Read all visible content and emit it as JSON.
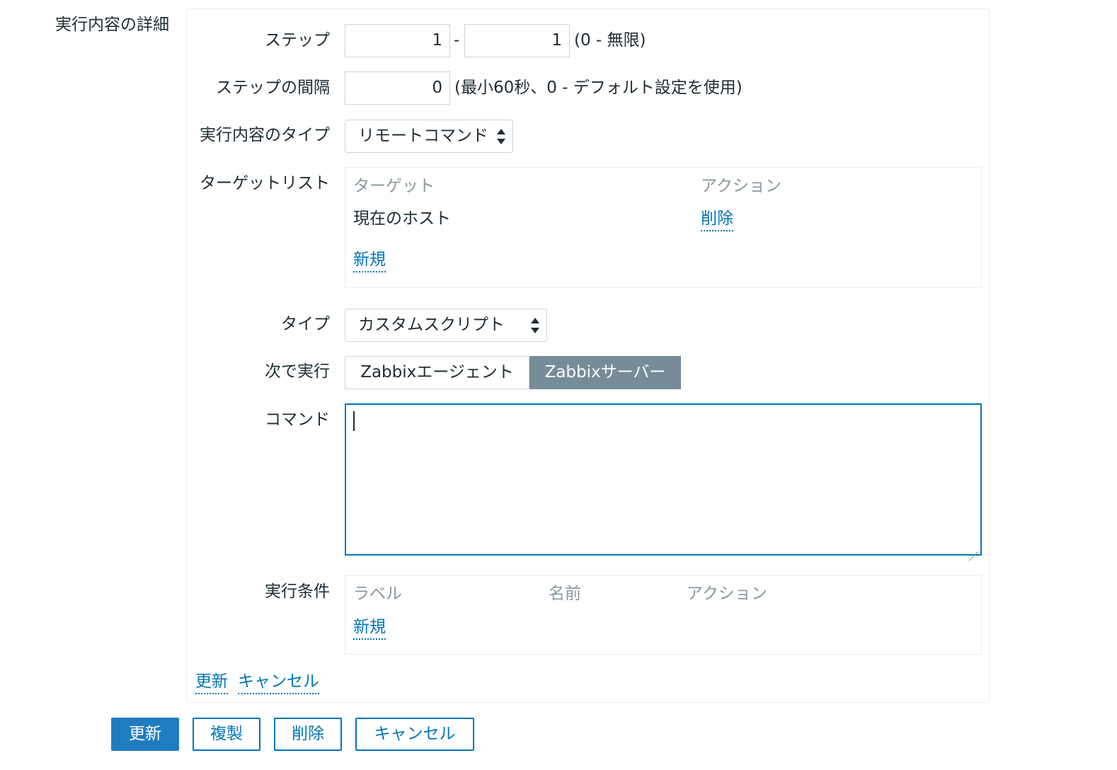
{
  "section": {
    "title": "実行内容の詳細"
  },
  "steps": {
    "label": "ステップ",
    "from": "1",
    "separator": "-",
    "to": "1",
    "note": "(0 - 無限)"
  },
  "step_interval": {
    "label": "ステップの間隔",
    "value": "0",
    "note": "(最小60秒、0 - デフォルト設定を使用)"
  },
  "operation_type": {
    "label": "実行内容のタイプ",
    "selected": "リモートコマンド"
  },
  "target_list": {
    "label": "ターゲットリスト",
    "headers": {
      "target": "ターゲット",
      "action": "アクション"
    },
    "rows": [
      {
        "target": "現在のホスト",
        "action": "削除"
      }
    ],
    "add_label": "新規"
  },
  "script_type": {
    "label": "タイプ",
    "selected": "カスタムスクリプト"
  },
  "execute_on": {
    "label": "次で実行",
    "options": [
      "Zabbixエージェント",
      "Zabbixサーバー"
    ],
    "selected": "Zabbixサーバー"
  },
  "command": {
    "label": "コマンド",
    "value": ""
  },
  "conditions": {
    "label": "実行条件",
    "headers": {
      "label": "ラベル",
      "name": "名前",
      "action": "アクション"
    },
    "add_label": "新規"
  },
  "inline_actions": {
    "update": "更新",
    "cancel": "キャンセル"
  },
  "footer_buttons": {
    "update": "更新",
    "clone": "複製",
    "delete": "削除",
    "cancel": "キャンセル"
  },
  "colors": {
    "link": "#0275b8",
    "primary_button": "#1f7dbf",
    "active_segment": "#768d99",
    "header_text": "#8a989e"
  }
}
